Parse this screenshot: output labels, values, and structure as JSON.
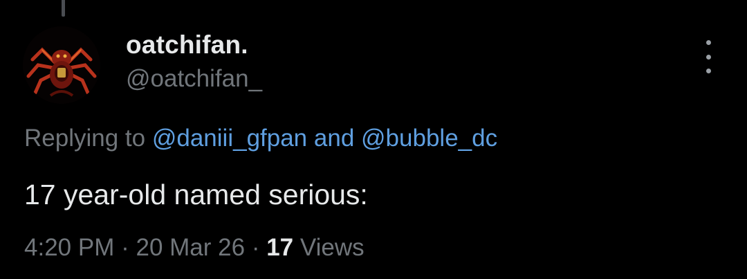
{
  "tweet": {
    "author": {
      "display_name": "oatchifan.",
      "handle": "@oatchifan_"
    },
    "reply": {
      "prefix": "Replying to",
      "mention_1": "@daniii_gfpan",
      "conjunction": "and",
      "mention_2": "@bubble_dc"
    },
    "text": "17 year-old named serious:",
    "meta": {
      "time": "4:20 PM",
      "separator": "·",
      "date": "20 Mar 26",
      "views_count": "17",
      "views_label": "Views"
    }
  },
  "icons": {
    "more": "more-vertical-icon",
    "avatar": "spider-avatar-image"
  },
  "colors": {
    "background": "#000000",
    "primary_text": "#e7e9ea",
    "secondary_text": "#71767b",
    "link": "#5f9fe0"
  }
}
